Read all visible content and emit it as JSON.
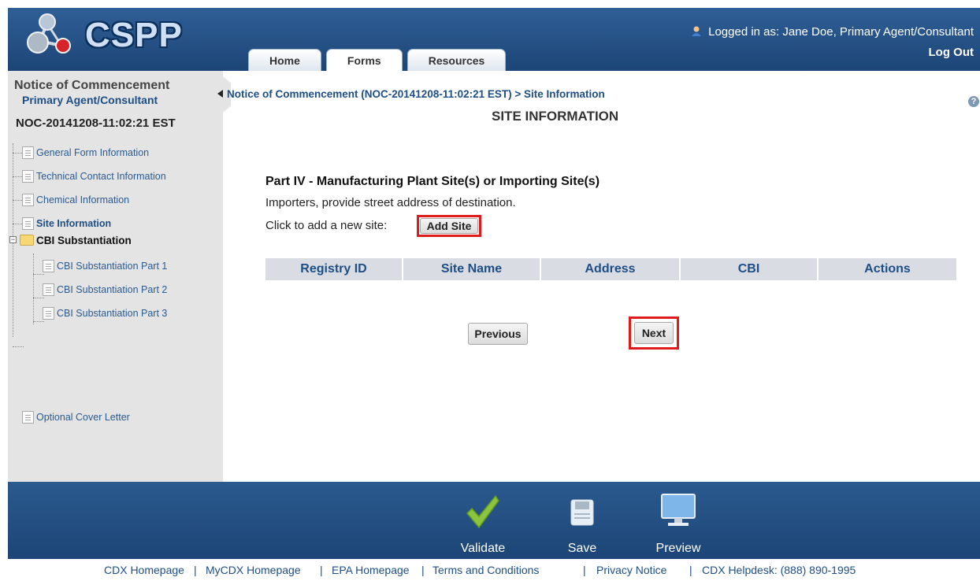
{
  "app": {
    "logo_text": "CSPP"
  },
  "tabs": [
    {
      "label": "Home"
    },
    {
      "label": "Forms"
    },
    {
      "label": "Resources"
    }
  ],
  "user": {
    "prefix": "Logged in as:",
    "name": "Jane Doe, Primary Agent/Consultant",
    "logout": "Log Out"
  },
  "sidebar": {
    "title": "Notice of Commencement",
    "role": "Primary Agent/Consultant",
    "noc_id": "NOC-20141208-11:02:21 EST",
    "items": [
      {
        "label": "General Form Information"
      },
      {
        "label": "Technical Contact Information"
      },
      {
        "label": "Chemical Information"
      },
      {
        "label": "Site Information"
      },
      {
        "label": "CBI Substantiation"
      },
      {
        "label": "CBI Substantiation Part 1"
      },
      {
        "label": "CBI Substantiation Part 2"
      },
      {
        "label": "CBI Substantiation Part 3"
      },
      {
        "label": "Optional Cover Letter"
      }
    ]
  },
  "main": {
    "breadcrumb": "Notice of Commencement (NOC-20141208-11:02:21 EST) > Site Information",
    "title": "SITE INFORMATION",
    "help": "?",
    "part_title": "Part IV - Manufacturing Plant Site(s) or Importing Site(s)",
    "instruction": "Importers, provide street address of destination.",
    "add_prompt": "Click to add a new site:",
    "add_button": "Add Site",
    "columns": [
      "Registry ID",
      "Site Name",
      "Address",
      "CBI",
      "Actions"
    ],
    "previous": "Previous",
    "next": "Next"
  },
  "actions": [
    {
      "label": "Validate"
    },
    {
      "label": "Save"
    },
    {
      "label": "Preview"
    }
  ],
  "footer_links": [
    "CDX Homepage",
    "|",
    "MyCDX Homepage",
    "|",
    "EPA Homepage",
    "|",
    "Terms and Conditions",
    "|",
    "Privacy Notice",
    "|",
    "CDX Helpdesk: (888) 890-1995"
  ],
  "colors": {
    "header": "#1d4577",
    "link": "#1e4e86",
    "highlight": "#e01b1b",
    "sidebar_bg": "#e4e4e4"
  }
}
